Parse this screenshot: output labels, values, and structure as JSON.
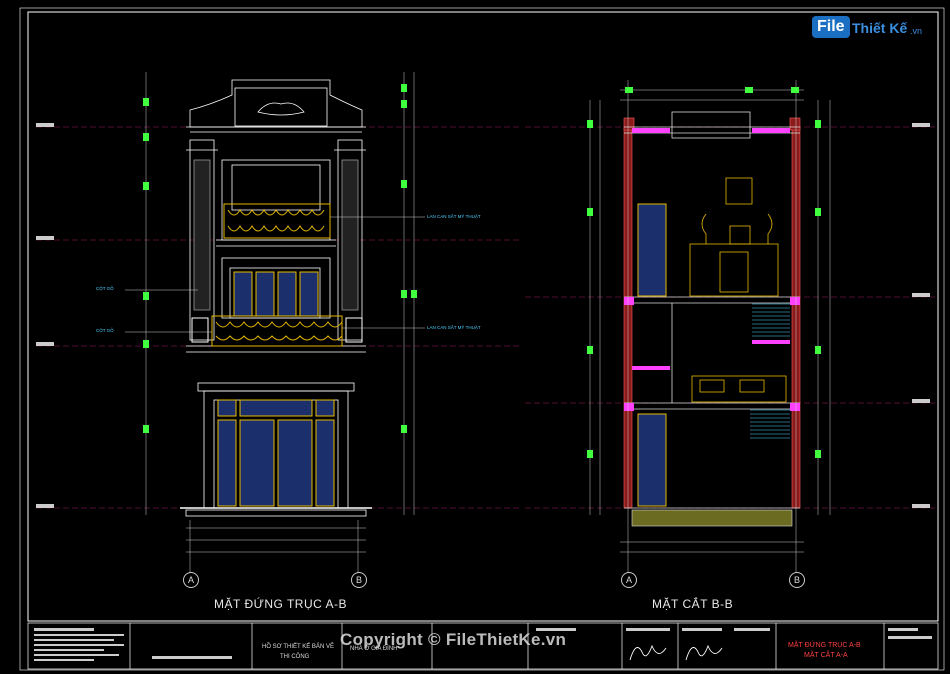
{
  "logo": {
    "file": "File",
    "rest": "Thiết Kế",
    "ext": ".vn"
  },
  "drawings": {
    "elevation_title": "MẶT ĐỨNG TRỤC A-B",
    "section_title": "MẶT CẮT B-B"
  },
  "axes": {
    "left_a": "A",
    "left_b": "B",
    "right_a": "A",
    "right_b": "B"
  },
  "annotations": {
    "railing_1": "LAN CAN SẮT MỸ THUẬT",
    "railing_2": "LAN CAN SẮT MỸ THUẬT",
    "column_1": "CỘT GỖ",
    "column_2": "CỘT GỖ"
  },
  "title_block": {
    "project_label": "HỒ SƠ THIẾT KẾ BẢN VẼ",
    "phase": "THI CÔNG",
    "building": "NHÀ Ở GIA ĐÌNH",
    "sheet_title_1": "MẶT ĐỨNG TRỤC A-B",
    "sheet_title_2": "MẶT CẮT A-A"
  },
  "watermark": "Copyright © FileThietKe.vn",
  "colors": {
    "gold": "#e6b800",
    "cyan": "#4fd1ff",
    "magenta": "#ff40ff",
    "wall": "#8b1a1a",
    "frame": "#ffffff",
    "glass": "#1a2f6b"
  }
}
